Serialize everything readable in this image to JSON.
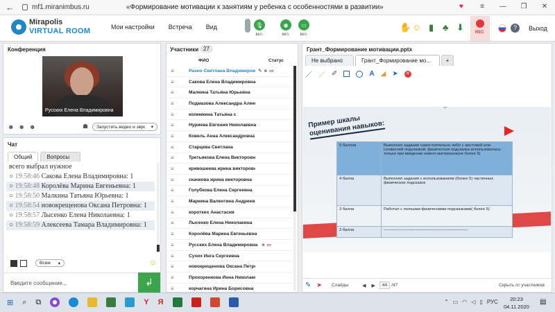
{
  "browser": {
    "url": "mf1.miranimbus.ru",
    "page_title": "«Формирование мотивации к занятиям у ребенка с особенностями в развитии»"
  },
  "app": {
    "logo_line1": "Mirapolis",
    "logo_line2": "VIRTUAL ROOM",
    "menu": [
      "Мои настройки",
      "Встреча",
      "Вид"
    ],
    "tool_labels": [
      "вкл.",
      "вкл.",
      "вкл."
    ],
    "rec_label": "REC",
    "exit_label": "Выход",
    "colors": {
      "accent": "#1e88c7",
      "green": "#3aa54a",
      "rec": "#e03a3a"
    }
  },
  "conference": {
    "title": "Конференция",
    "video_name": "Русских Елена Владимировна",
    "video_button": "Запустить видео и звук"
  },
  "chat": {
    "title": "Чат",
    "tabs": [
      "Общий",
      "Вопросы"
    ],
    "messages": [
      {
        "time": "",
        "text": "всего выбрал нужное"
      },
      {
        "time": "19:58:46",
        "text": "Сакова Елена Владимировна: 1"
      },
      {
        "time": "19:58:48",
        "text": "Королёва Марина Евгеньевна: 1"
      },
      {
        "time": "19:58:50",
        "text": "Малкина Татьяна Юрьевна: 1"
      },
      {
        "time": "19:58:54",
        "text": "новокрещенова Оксана Петровна: 1"
      },
      {
        "time": "19:58:57",
        "text": "Лысенко Елена Николаевна: 1"
      },
      {
        "time": "19:58:59",
        "text": "Алексеева Тамара Владимировна: 1"
      }
    ],
    "recipient": "Всем",
    "input_placeholder": "Введите сообщение..."
  },
  "participants": {
    "title": "Участники",
    "count": "27",
    "col_name": "ФИО",
    "col_status": "Статус",
    "list": [
      "Рахно Светлана Владимировна",
      "Сакова Елена Владимировна",
      "Малкина Татьяна Юрьевна",
      "Подмазова Александра Александровна",
      "колемкина Татьяна с",
      "Нуриева Евгения Николаевна",
      "Ковель Анна Александровна",
      "Старцева Светлана",
      "Третьякова Елена Викторовна",
      "кривошеева ирина викторовна",
      "скачкова ирина викторовна",
      "Голубкова Елена Сергеевна",
      "Маркина Валентина Андреевна",
      "коротких Анастасия",
      "Лысенко Елена Николаевна",
      "Королёва Марина Евгеньевна",
      "Русских Елена Владимировна",
      "Сухих Инга Сергеевна",
      "новокрещенова Оксана Петровна",
      "Прохоренкова Инна Николаевна",
      "корчагина Ирина Борисовна"
    ]
  },
  "presentation": {
    "title": "Грант_Формирование мотивации.pptx",
    "tabs": [
      "Не выбрано",
      "Грант_Формирование мо..."
    ],
    "slide_heading_line1": "Пример шкалы",
    "slide_heading_line2": "оценивания навыков:",
    "table": [
      {
        "score": "5 баллов",
        "desc": "Выполнял задания самостоятельно либо с жестовой или словесной подсказкой, физическая подсказка использовалась только при введении нового материала(не более 5)"
      },
      {
        "score": "4 балла",
        "desc": "Выполнял задания с использованием (более 5) частичных физических подсказок"
      },
      {
        "score": "3 балла",
        "desc": "Работал с полными физическими подсказками( более 5)"
      },
      {
        "score": "2 балла",
        "desc": "---------------------------------------------------------------"
      }
    ],
    "footer_slides": "Слайды",
    "current_page": "44",
    "total_pages": "/47",
    "hide_label": "Скрыть от участников"
  },
  "taskbar": {
    "lang": "РУС",
    "time": "20:23",
    "date": "04.11.2020"
  }
}
